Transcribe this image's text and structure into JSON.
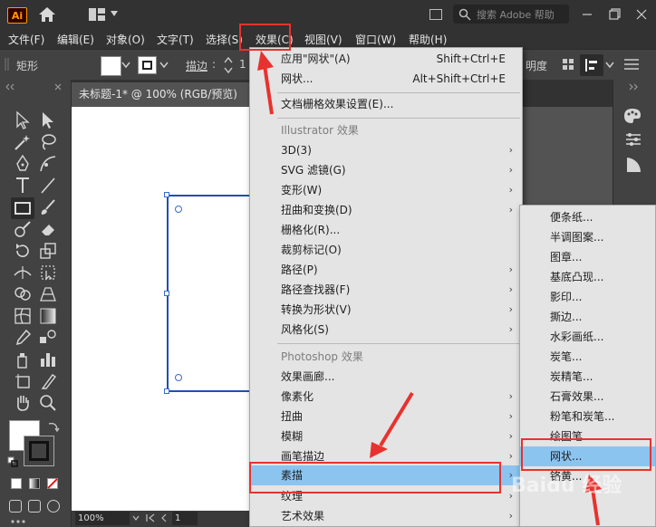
{
  "app": {
    "logo": "Ai"
  },
  "search": {
    "placeholder": "搜索 Adobe 帮助"
  },
  "menubar": {
    "items": [
      "文件(F)",
      "编辑(E)",
      "对象(O)",
      "文字(T)",
      "选择(S)",
      "效果(C)",
      "视图(V)",
      "窗口(W)",
      "帮助(H)"
    ]
  },
  "controlbar": {
    "shape_label": "矩形",
    "stroke_label": "描边",
    "stroke_value": "1",
    "opacity_label": "明度"
  },
  "document": {
    "tab_title": "未标题-1* @ 100% (RGB/预览)"
  },
  "statusbar": {
    "zoom": "100%",
    "page": "1"
  },
  "effect_menu": {
    "items": [
      {
        "label": "应用\"网状\"(A)",
        "shortcut": "Shift+Ctrl+E"
      },
      {
        "label": "网状...",
        "shortcut": "Alt+Shift+Ctrl+E"
      },
      {
        "label": "文档栅格效果设置(E)..."
      },
      {
        "label": "Illustrator 效果",
        "header": true
      },
      {
        "label": "3D(3)",
        "submenu": true
      },
      {
        "label": "SVG 滤镜(G)",
        "submenu": true
      },
      {
        "label": "变形(W)",
        "submenu": true
      },
      {
        "label": "扭曲和变换(D)",
        "submenu": true
      },
      {
        "label": "栅格化(R)..."
      },
      {
        "label": "裁剪标记(O)"
      },
      {
        "label": "路径(P)",
        "submenu": true
      },
      {
        "label": "路径查找器(F)",
        "submenu": true
      },
      {
        "label": "转换为形状(V)",
        "submenu": true
      },
      {
        "label": "风格化(S)",
        "submenu": true
      },
      {
        "label": "Photoshop 效果",
        "header": true
      },
      {
        "label": "效果画廊..."
      },
      {
        "label": "像素化",
        "submenu": true
      },
      {
        "label": "扭曲",
        "submenu": true
      },
      {
        "label": "模糊",
        "submenu": true
      },
      {
        "label": "画笔描边",
        "submenu": true
      },
      {
        "label": "素描",
        "submenu": true,
        "highlighted": true
      },
      {
        "label": "纹理",
        "submenu": true
      },
      {
        "label": "艺术效果",
        "submenu": true
      }
    ]
  },
  "sketch_submenu": {
    "items": [
      "便条纸...",
      "半调图案...",
      "图章...",
      "基底凸现...",
      "影印...",
      "撕边...",
      "水彩画纸...",
      "炭笔...",
      "炭精笔...",
      "石膏效果...",
      "粉笔和炭笔...",
      "绘图笔...",
      "网状...",
      "铬黄..."
    ],
    "highlighted_index": 12
  },
  "watermark": {
    "text": "Baidu 经验"
  },
  "colors": {
    "highlight": "#8cc4f0",
    "annotation_red": "#e8322f",
    "selection_blue": "#3a6bd4"
  }
}
